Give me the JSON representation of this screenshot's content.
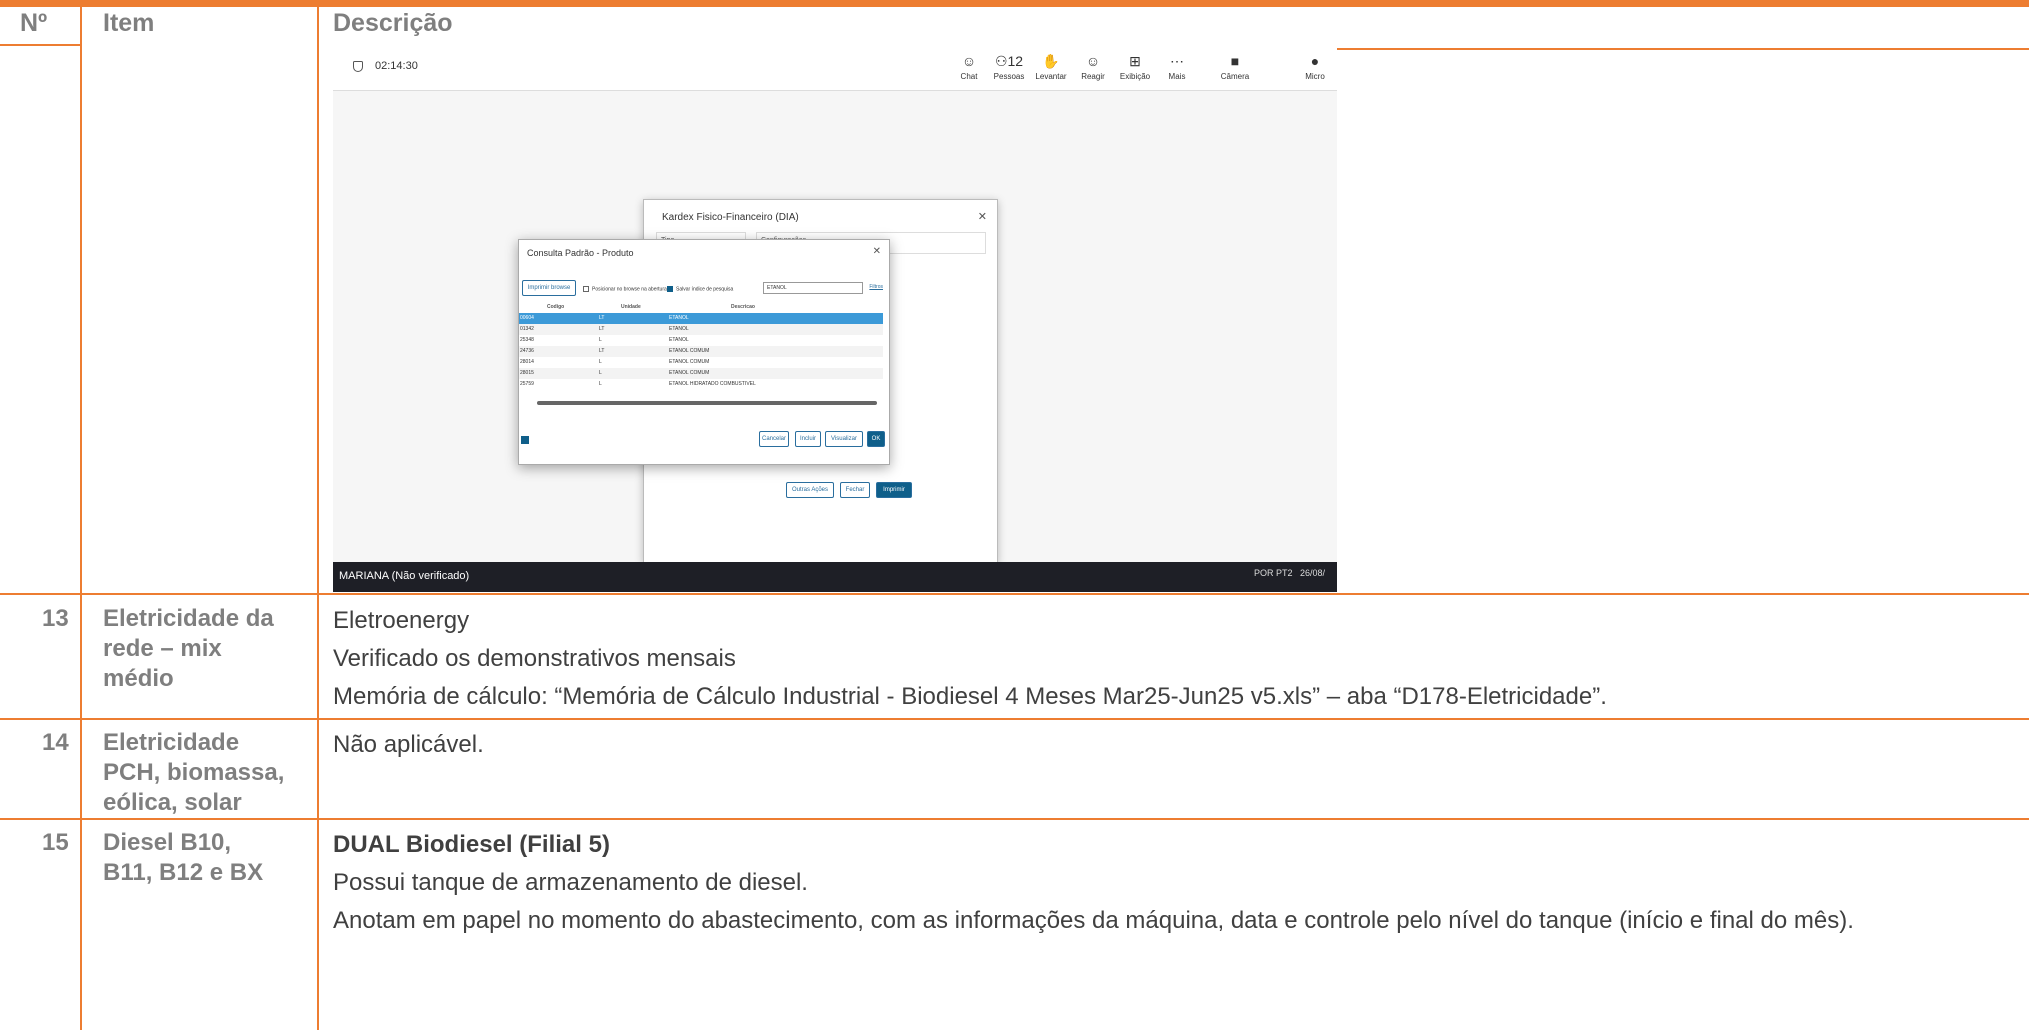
{
  "header": {
    "no": "Nº",
    "item": "Item",
    "desc": "Descrição"
  },
  "screenshot": {
    "timer": "02:14:30",
    "toolbar": [
      {
        "label": "Chat",
        "icon": "chat-icon",
        "glyph": "☺"
      },
      {
        "label": "Pessoas",
        "icon": "people-icon",
        "glyph": "⚇12"
      },
      {
        "label": "Levantar",
        "icon": "raise-hand-icon",
        "glyph": "✋"
      },
      {
        "label": "Reagir",
        "icon": "react-icon",
        "glyph": "☺"
      },
      {
        "label": "Exibição",
        "icon": "view-icon",
        "glyph": "⊞"
      },
      {
        "label": "Mais",
        "icon": "more-icon",
        "glyph": "⋯"
      },
      {
        "label": "Câmera",
        "icon": "camera-icon",
        "glyph": "■"
      },
      {
        "label": "Micro",
        "icon": "mic-icon",
        "glyph": "●"
      }
    ],
    "back_dialog": {
      "title": "Kardex Fisico-Financeiro (DIA)",
      "tipo": "Tipo",
      "config": "Configurações",
      "buttons": [
        "Outras Ações",
        "Fechar",
        "Imprimir"
      ]
    },
    "dialog": {
      "title": "Consulta Padrão - Produto",
      "browse_button": "Imprimir browse",
      "check1": "Posicionar no browse na abertura",
      "check2": "Salvar índice de pesquisa",
      "search_value": "ETANOL",
      "filtro": "Filtros",
      "columns": [
        "Codigo",
        "Unidade",
        "Descricao"
      ],
      "rows": [
        {
          "codigo": "00604",
          "unidade": "LT",
          "descricao": "ETANOL"
        },
        {
          "codigo": "01342",
          "unidade": "LT",
          "descricao": "ETANOL"
        },
        {
          "codigo": "25348",
          "unidade": "L",
          "descricao": "ETANOL"
        },
        {
          "codigo": "24736",
          "unidade": "LT",
          "descricao": "ETANOL COMUM"
        },
        {
          "codigo": "28014",
          "unidade": "L",
          "descricao": "ETANOL COMUM"
        },
        {
          "codigo": "28015",
          "unidade": "L",
          "descricao": "ETANOL COMUM"
        },
        {
          "codigo": "25759",
          "unidade": "L",
          "descricao": "ETANOL HIDRATADO COMBUSTIVEL"
        }
      ],
      "buttons": [
        "Cancelar",
        "Incluir",
        "Visualizar",
        "OK"
      ]
    },
    "taskbar": {
      "user": "MARIANA (Não verificado)",
      "tray": "POR PT2",
      "date": "26/08/"
    }
  },
  "rows": [
    {
      "no": "13",
      "item": [
        "Eletricidade da",
        "rede – mix",
        "médio"
      ],
      "desc": [
        "Eletroenergy",
        "Verificado os demonstrativos mensais",
        "Memória de cálculo: “Memória de Cálculo Industrial - Biodiesel 4 Meses Mar25-Jun25 v5.xls” – aba “D178-Eletricidade”."
      ]
    },
    {
      "no": "14",
      "item": [
        "Eletricidade",
        "PCH, biomassa,",
        "eólica, solar"
      ],
      "desc": [
        "Não aplicável."
      ]
    },
    {
      "no": "15",
      "item": [
        "Diesel B10,",
        "B11, B12 e BX"
      ],
      "desc_title": "DUAL Biodiesel (Filial 5)",
      "desc": [
        "Possui tanque de armazenamento de diesel.",
        "Anotam em papel no momento do abastecimento, com as informações da máquina, data e controle pelo nível do tanque (início e final do mês)."
      ]
    }
  ]
}
